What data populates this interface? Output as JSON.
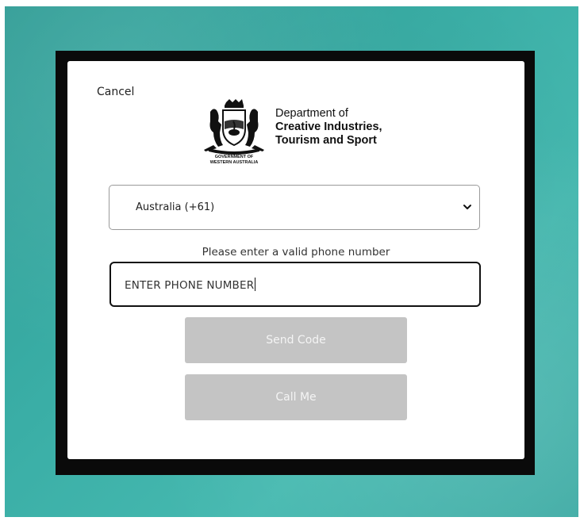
{
  "dialog": {
    "cancel_label": "Cancel"
  },
  "logo": {
    "crest_caption_line1": "GOVERNMENT OF",
    "crest_caption_line2": "WESTERN AUSTRALIA",
    "department_line1": "Department of",
    "department_line2": "Creative Industries,",
    "department_line3": "Tourism and Sport"
  },
  "form": {
    "country_select": {
      "selected_value": "Australia (+61)"
    },
    "helper_text": "Please enter a valid phone number",
    "phone_input": {
      "value": "ENTER PHONE NUMBER"
    },
    "send_code_label": "Send Code",
    "call_me_label": "Call Me"
  },
  "colors": {
    "background_teal": "#3aaea6",
    "frame": "#0a0a0a",
    "disabled_button": "#c4c4c4"
  },
  "icons": {
    "crest": "coat-of-arms-icon",
    "select_arrow": "chevron-down-icon"
  }
}
